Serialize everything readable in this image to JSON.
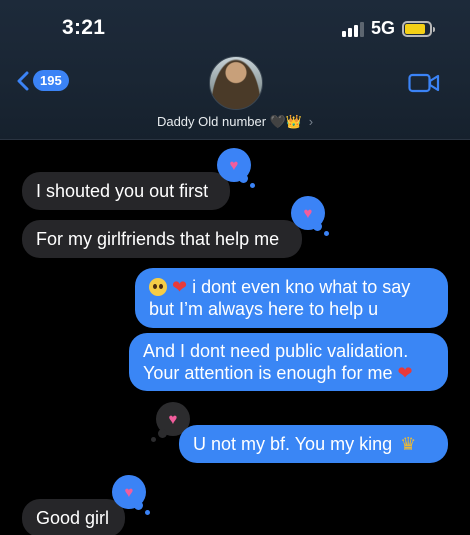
{
  "status_bar": {
    "time": "3:21",
    "network": "5G",
    "battery_level": 0.85
  },
  "nav": {
    "back_badge": "195",
    "contact_name": "Daddy Old number",
    "contact_suffix": "🖤👑",
    "chevron": "›"
  },
  "icons": {
    "back": "chevron-left-icon",
    "video": "video-camera-icon",
    "tapback": "heart-icon"
  },
  "colors": {
    "incoming_bubble": "#262629",
    "outgoing_bubble": "#3a86f5",
    "accent": "#3b83f6",
    "tapback_heart": "#f25d9c"
  },
  "messages": [
    {
      "direction": "incoming",
      "text": "I shouted you out first",
      "tapback": "heart"
    },
    {
      "direction": "incoming",
      "text": "For my girlfriends that help me",
      "tapback": "heart"
    },
    {
      "direction": "outgoing",
      "emoji_prefix": "🥺",
      "heart": "❤️",
      "line1": "i dont even kno what to say",
      "line2": "but I’m always here to help u"
    },
    {
      "direction": "outgoing",
      "line1": "And I dont need public validation.",
      "line2": "Your attention is enough for me",
      "heart": "❤️"
    },
    {
      "direction": "outgoing",
      "text": "U not my bf. You my king",
      "emoji": "👑",
      "tapback": "heart"
    },
    {
      "direction": "incoming",
      "text": "Good girl",
      "tapback": "heart"
    }
  ]
}
